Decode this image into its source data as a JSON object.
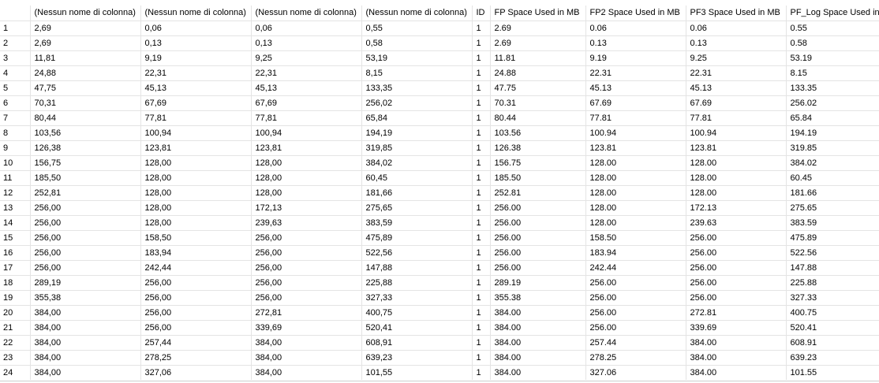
{
  "grid": {
    "headers": [
      "",
      "(Nessun nome di colonna)",
      "(Nessun nome di colonna)",
      "(Nessun nome di colonna)",
      "(Nessun nome di colonna)",
      "ID",
      "FP Space Used in MB",
      "FP2 Space Used in MB",
      "PF3 Space Used in MB",
      "PF_Log Space Used in"
    ],
    "rows": [
      [
        "1",
        "2,69",
        "0,06",
        "0,06",
        "0,55",
        "1",
        "2.69",
        "0.06",
        "0.06",
        "0.55"
      ],
      [
        "2",
        "2,69",
        "0,13",
        "0,13",
        "0,58",
        "1",
        "2.69",
        "0.13",
        "0.13",
        "0.58"
      ],
      [
        "3",
        "11,81",
        "9,19",
        "9,25",
        "53,19",
        "1",
        "11.81",
        "9.19",
        "9.25",
        "53.19"
      ],
      [
        "4",
        "24,88",
        "22,31",
        "22,31",
        "8,15",
        "1",
        "24.88",
        "22.31",
        "22.31",
        "8.15"
      ],
      [
        "5",
        "47,75",
        "45,13",
        "45,13",
        "133,35",
        "1",
        "47.75",
        "45.13",
        "45.13",
        "133.35"
      ],
      [
        "6",
        "70,31",
        "67,69",
        "67,69",
        "256,02",
        "1",
        "70.31",
        "67.69",
        "67.69",
        "256.02"
      ],
      [
        "7",
        "80,44",
        "77,81",
        "77,81",
        "65,84",
        "1",
        "80.44",
        "77.81",
        "77.81",
        "65.84"
      ],
      [
        "8",
        "103,56",
        "100,94",
        "100,94",
        "194,19",
        "1",
        "103.56",
        "100.94",
        "100.94",
        "194.19"
      ],
      [
        "9",
        "126,38",
        "123,81",
        "123,81",
        "319,85",
        "1",
        "126.38",
        "123.81",
        "123.81",
        "319.85"
      ],
      [
        "10",
        "156,75",
        "128,00",
        "128,00",
        "384,02",
        "1",
        "156.75",
        "128.00",
        "128.00",
        "384.02"
      ],
      [
        "11",
        "185,50",
        "128,00",
        "128,00",
        "60,45",
        "1",
        "185.50",
        "128.00",
        "128.00",
        "60.45"
      ],
      [
        "12",
        "252,81",
        "128,00",
        "128,00",
        "181,66",
        "1",
        "252.81",
        "128.00",
        "128.00",
        "181.66"
      ],
      [
        "13",
        "256,00",
        "128,00",
        "172,13",
        "275,65",
        "1",
        "256.00",
        "128.00",
        "172.13",
        "275.65"
      ],
      [
        "14",
        "256,00",
        "128,00",
        "239,63",
        "383,59",
        "1",
        "256.00",
        "128.00",
        "239.63",
        "383.59"
      ],
      [
        "15",
        "256,00",
        "158,50",
        "256,00",
        "475,89",
        "1",
        "256.00",
        "158.50",
        "256.00",
        "475.89"
      ],
      [
        "16",
        "256,00",
        "183,94",
        "256,00",
        "522,56",
        "1",
        "256.00",
        "183.94",
        "256.00",
        "522.56"
      ],
      [
        "17",
        "256,00",
        "242,44",
        "256,00",
        "147,88",
        "1",
        "256.00",
        "242.44",
        "256.00",
        "147.88"
      ],
      [
        "18",
        "289,19",
        "256,00",
        "256,00",
        "225,88",
        "1",
        "289.19",
        "256.00",
        "256.00",
        "225.88"
      ],
      [
        "19",
        "355,38",
        "256,00",
        "256,00",
        "327,33",
        "1",
        "355.38",
        "256.00",
        "256.00",
        "327.33"
      ],
      [
        "20",
        "384,00",
        "256,00",
        "272,81",
        "400,75",
        "1",
        "384.00",
        "256.00",
        "272.81",
        "400.75"
      ],
      [
        "21",
        "384,00",
        "256,00",
        "339,69",
        "520,41",
        "1",
        "384.00",
        "256.00",
        "339.69",
        "520.41"
      ],
      [
        "22",
        "384,00",
        "257,44",
        "384,00",
        "608,91",
        "1",
        "384.00",
        "257.44",
        "384.00",
        "608.91"
      ],
      [
        "23",
        "384,00",
        "278,25",
        "384,00",
        "639,23",
        "1",
        "384.00",
        "278.25",
        "384.00",
        "639.23"
      ],
      [
        "24",
        "384,00",
        "327,06",
        "384,00",
        "101,55",
        "1",
        "384.00",
        "327.06",
        "384.00",
        "101.55"
      ]
    ]
  }
}
